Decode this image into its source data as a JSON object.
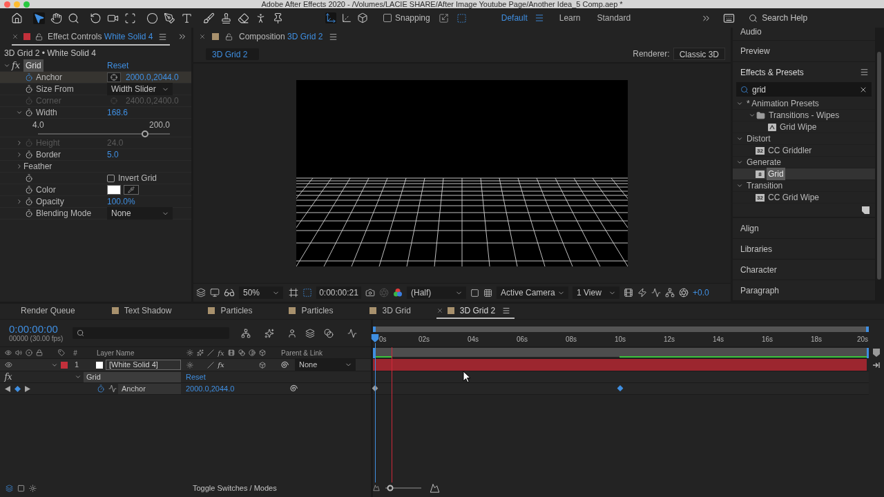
{
  "window": {
    "title": "Adobe After Effects 2020 - /Volumes/LACIE SHARE/After Image Youtube Page/Another Idea_5 Comp.aep *"
  },
  "toolbar": {
    "tool_groups": [
      [
        {
          "kind": "home",
          "selected": false
        }
      ],
      [
        {
          "kind": "selection",
          "selected": true
        },
        {
          "kind": "hand",
          "selected": false
        },
        {
          "kind": "zoom",
          "selected": false
        }
      ],
      [
        {
          "kind": "rotate",
          "selected": false
        },
        {
          "kind": "camera",
          "selected": false
        },
        {
          "kind": "pan",
          "selected": false
        }
      ],
      [
        {
          "kind": "ellipse",
          "selected": false
        },
        {
          "kind": "pen",
          "selected": false
        },
        {
          "kind": "type",
          "selected": false
        }
      ],
      [
        {
          "kind": "brush",
          "selected": false
        },
        {
          "kind": "clone",
          "selected": false
        },
        {
          "kind": "eraser",
          "selected": false
        },
        {
          "kind": "roto",
          "selected": false
        },
        {
          "kind": "pin",
          "selected": false
        }
      ]
    ],
    "axis_modes": [
      {
        "kind": "local",
        "selected": true
      },
      {
        "kind": "world",
        "selected": false
      },
      {
        "kind": "view",
        "selected": false
      }
    ],
    "snapping": {
      "label": "Snapping",
      "checked": false
    },
    "workspaces": [
      {
        "label": "Default",
        "selected": true
      },
      {
        "label": "Learn",
        "selected": false
      },
      {
        "label": "Standard",
        "selected": false
      }
    ],
    "search": {
      "placeholder": "Search Help"
    }
  },
  "effect_controls": {
    "tab": {
      "label": "Effect Controls",
      "target": "White Solid 4",
      "color": "#c3303b"
    },
    "subtitle": "3D Grid 2 • White Solid 4",
    "effect": {
      "fx": "fx",
      "name": "Grid",
      "reset": "Reset",
      "expanded": true,
      "selected": true
    },
    "properties": [
      {
        "kind": "point",
        "name": "Anchor",
        "value": "2000.0,2044.0",
        "animated": true,
        "disabled": false,
        "selected": true
      },
      {
        "kind": "dropdown",
        "name": "Size From",
        "value": "Width Slider",
        "animated": false,
        "disabled": false,
        "selected": false
      },
      {
        "kind": "point",
        "name": "Corner",
        "value": "2400.0,2400.0",
        "animated": false,
        "disabled": true,
        "selected": false
      },
      {
        "kind": "number",
        "name": "Width",
        "value": "168.6",
        "expanded": true,
        "animated": false,
        "disabled": false,
        "selected": false,
        "slider": {
          "min": "4.0",
          "max": "200.0",
          "level": 0.81
        }
      },
      {
        "kind": "number",
        "name": "Height",
        "value": "24.0",
        "expanded": false,
        "animated": false,
        "disabled": true,
        "selected": false
      },
      {
        "kind": "number",
        "name": "Border",
        "value": "5.0",
        "expanded": false,
        "animated": false,
        "disabled": false,
        "selected": false
      },
      {
        "kind": "group",
        "name": "Feather",
        "expanded": false,
        "selected": false
      },
      {
        "kind": "checkbox",
        "label": "Invert Grid",
        "checked": false,
        "animated": false,
        "disabled": false,
        "selected": false
      },
      {
        "kind": "color",
        "name": "Color",
        "color": "#ffffff",
        "animated": false,
        "disabled": false,
        "selected": false
      },
      {
        "kind": "number",
        "name": "Opacity",
        "value": "100.0%",
        "expanded": false,
        "animated": false,
        "disabled": false,
        "selected": false
      },
      {
        "kind": "dropdown",
        "name": "Blending Mode",
        "value": "None",
        "animated": false,
        "disabled": false,
        "selected": false
      }
    ]
  },
  "composition": {
    "tab": {
      "label": "Composition",
      "target": "3D Grid 2",
      "color": "#a8916d"
    },
    "breadcrumb": "3D Grid 2",
    "renderer_label": "Renderer:",
    "renderer": "Classic 3D",
    "viewer_bar": {
      "magnification": "50%",
      "timecode": "0:00:00:21",
      "resolution": "(Half)",
      "view": "Active Camera",
      "layout": "1 View",
      "exposure": "+0.0"
    }
  },
  "panels": {
    "above": [
      "Audio",
      "Preview"
    ],
    "effects_presets": {
      "title": "Effects & Presets",
      "search": {
        "value": "grid"
      },
      "tree": [
        {
          "label": "* Animation Presets",
          "expanded": true,
          "selected": false,
          "children": [
            {
              "label": "Transitions - Wipes",
              "kind": "folder",
              "expanded": true,
              "selected": false,
              "children": [
                {
                  "label": "Grid Wipe",
                  "kind": "preset",
                  "selected": false
                }
              ]
            }
          ]
        },
        {
          "label": "Distort",
          "expanded": true,
          "selected": false,
          "children": [
            {
              "label": "CC Griddler",
              "kind": "effect",
              "bit_depth": "32",
              "selected": false
            }
          ]
        },
        {
          "label": "Generate",
          "expanded": true,
          "selected": false,
          "children": [
            {
              "label": "Grid",
              "kind": "effect",
              "bit_depth": "8",
              "selected": true
            }
          ]
        },
        {
          "label": "Transition",
          "expanded": true,
          "selected": false,
          "children": [
            {
              "label": "CC Grid Wipe",
              "kind": "effect",
              "bit_depth": "32",
              "selected": false
            }
          ]
        }
      ]
    },
    "below": [
      "Align",
      "Libraries",
      "Character",
      "Paragraph"
    ]
  },
  "timeline": {
    "tabs": [
      {
        "label": "Render Queue",
        "selected": false
      },
      {
        "label": "Text Shadow",
        "color": "#a8916d",
        "selected": false
      },
      {
        "label": "Particles",
        "color": "#a8916d",
        "selected": false
      },
      {
        "label": "Particles",
        "color": "#a8916d",
        "selected": false
      },
      {
        "label": "3D Grid",
        "color": "#a8916d",
        "selected": false
      },
      {
        "label": "3D Grid 2",
        "color": "#a8916d",
        "selected": true
      }
    ],
    "timecode": "0:00:00:00",
    "frame_info": "00000 (30.00 fps)",
    "columns": {
      "number": "#",
      "layer_name": "Layer Name",
      "fx_switch": "fx",
      "parent": "Parent & Link"
    },
    "layers": [
      {
        "number": "1",
        "name": "[White Solid 4]",
        "color": "#c3303b",
        "visible": true,
        "expanded": true,
        "fx_switch": "fx",
        "effects_on": true,
        "parent": "None",
        "effects": [
          {
            "fx": "fx",
            "name": "Grid",
            "reset": "Reset",
            "expanded": true,
            "properties": [
              {
                "name": "Anchor",
                "value": "2000.0,2044.0",
                "animated": true,
                "at_keyframe": true,
                "keyframes": [
                  {
                    "level": 0,
                    "selected": false
                  },
                  {
                    "level": 0.5,
                    "selected": true
                  }
                ]
              }
            ]
          }
        ]
      }
    ],
    "ruler": [
      "0s",
      "02s",
      "04s",
      "06s",
      "08s",
      "10s",
      "12s",
      "14s",
      "16s",
      "18s",
      "20s"
    ],
    "playhead": {
      "level": 0
    },
    "preview_time": {
      "level": 0.034
    },
    "footer": {
      "toggle": "Toggle Switches / Modes",
      "zoom": {
        "level": 0.13
      }
    }
  }
}
